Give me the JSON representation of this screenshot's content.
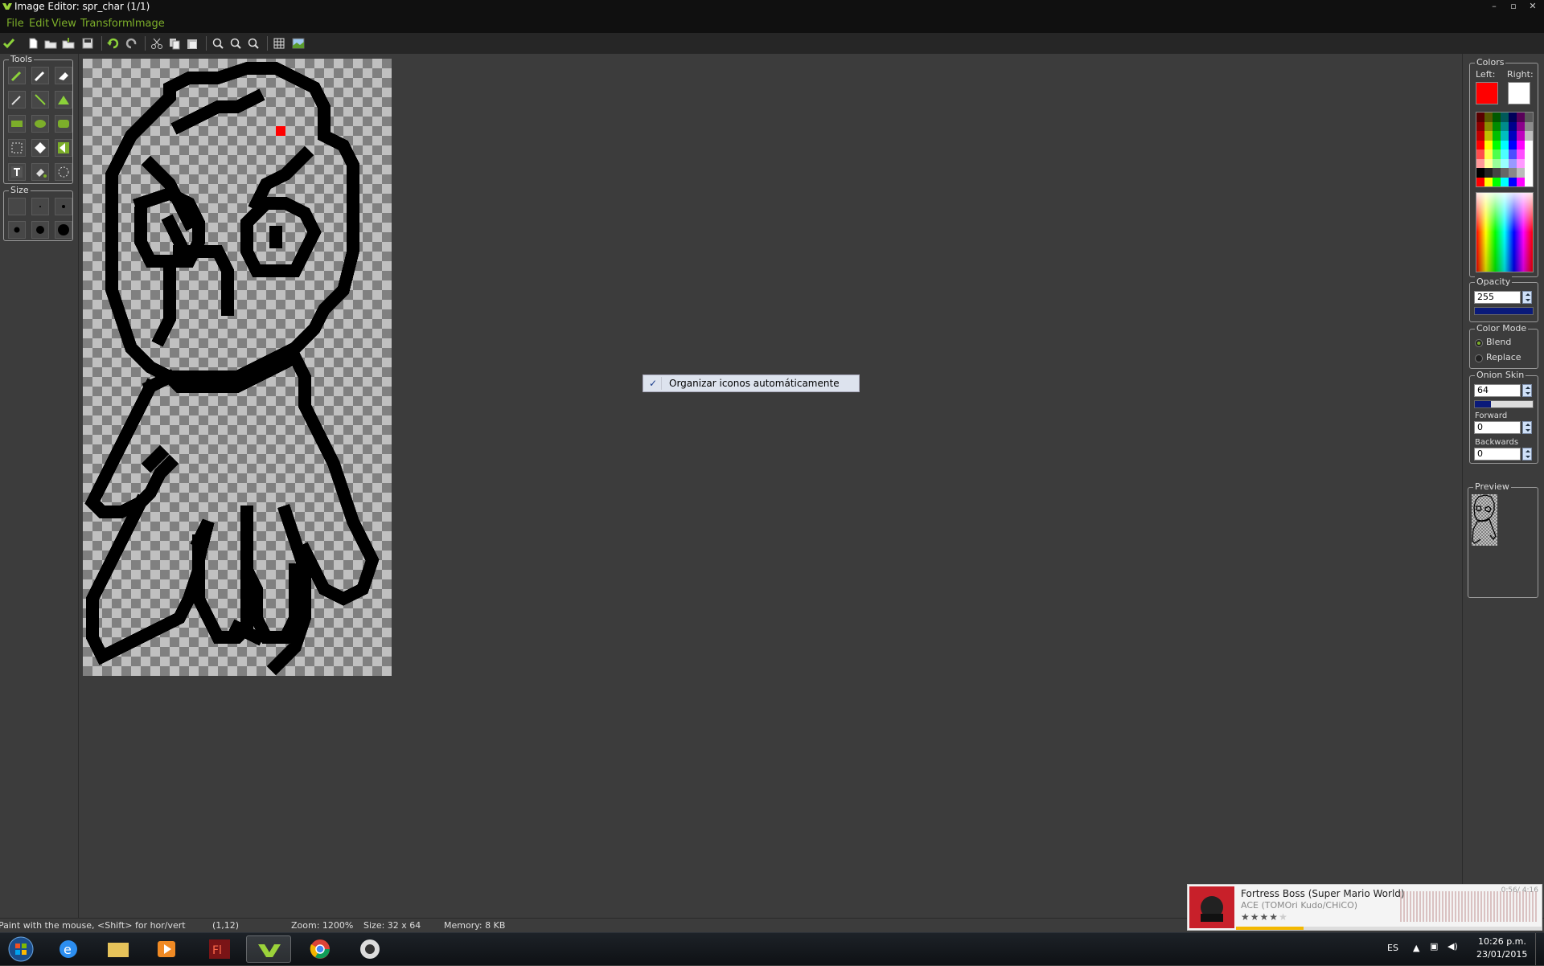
{
  "window": {
    "title": "Image Editor: spr_char (1/1)"
  },
  "menu": [
    {
      "label": "File"
    },
    {
      "label": "Edit"
    },
    {
      "label": "View"
    },
    {
      "label": "Transform"
    },
    {
      "label": "Image"
    }
  ],
  "left": {
    "tools_title": "Tools",
    "size_title": "Size"
  },
  "context_menu": {
    "item": "Organizar iconos automáticamente",
    "checked": true
  },
  "right": {
    "colors_title": "Colors",
    "left_label": "Left:",
    "right_label": "Right:",
    "left_color": "#ff0000",
    "right_color": "#ffffff",
    "opacity_title": "Opacity",
    "opacity_value": "255",
    "colormode_title": "Color Mode",
    "blend_label": "Blend",
    "replace_label": "Replace",
    "onion_title": "Onion Skin",
    "onion_value": "64",
    "forward_label": "Forward",
    "forward_value": "0",
    "backwards_label": "Backwards",
    "backwards_value": "0",
    "preview_title": "Preview"
  },
  "status": {
    "hint": "Paint with the mouse, <Shift> for hor/vert",
    "coords": "(1,12)",
    "zoom": "Zoom: 1200%",
    "size": "Size: 32 x 64",
    "memory": "Memory: 8 KB"
  },
  "media": {
    "title": "Fortress Boss (Super Mario World)",
    "artist": "ACE (TOMOri Kudo/CHiCO)",
    "time": "0:56/ 4:16",
    "rating": 4,
    "progress": 0.22
  },
  "taskbar": {
    "lang": "ES",
    "time": "10:26 p.m.",
    "date": "23/01/2015"
  }
}
